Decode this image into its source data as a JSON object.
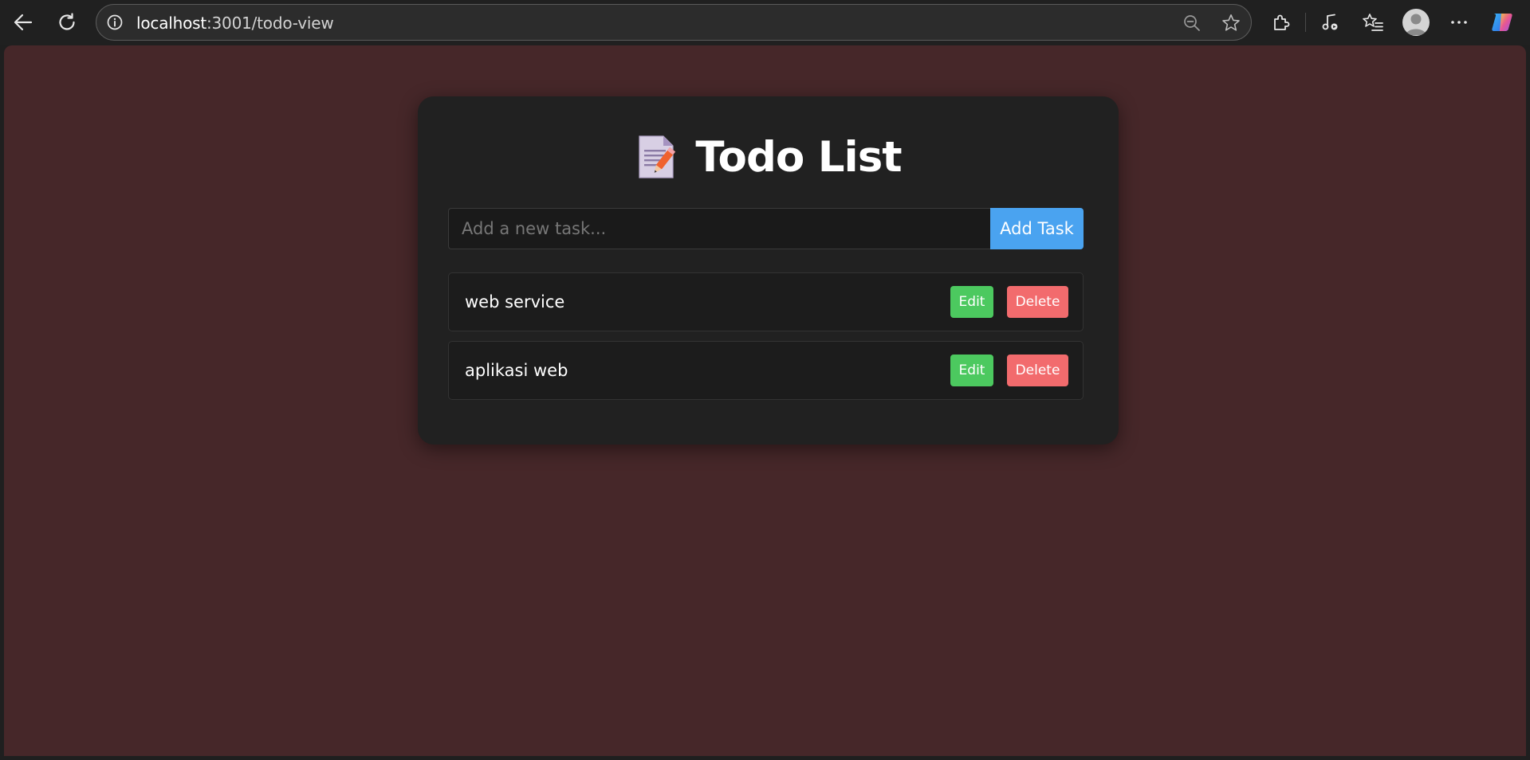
{
  "browser": {
    "url_host": "localhost",
    "url_rest": ":3001/todo-view",
    "icons": {
      "back": "back-arrow-icon",
      "reload": "reload-icon",
      "site_info": "info-icon",
      "zoom": "zoom-out-icon",
      "favorite": "star-icon",
      "extensions": "puzzle-icon",
      "media": "media-control-icon",
      "favorites": "favorites-list-icon",
      "profile": "profile-avatar",
      "more": "more-dots-icon",
      "copilot": "copilot-icon"
    }
  },
  "app": {
    "title": "Todo List",
    "title_icon": "memo-icon",
    "input_placeholder": "Add a new task...",
    "input_value": "",
    "add_button_label": "Add Task",
    "colors": {
      "page_background": "#462729",
      "card_background": "#212121",
      "add_button": "#4aa3f0",
      "edit_button": "#4cc95f",
      "delete_button": "#f26b6d"
    },
    "todos": [
      {
        "text": "web service",
        "edit_label": "Edit",
        "delete_label": "Delete"
      },
      {
        "text": "aplikasi web",
        "edit_label": "Edit",
        "delete_label": "Delete"
      }
    ]
  }
}
